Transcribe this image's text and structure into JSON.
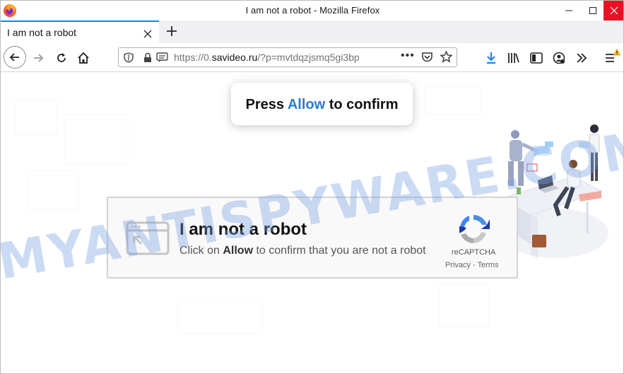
{
  "window": {
    "title": "I am not a robot - Mozilla Firefox"
  },
  "tabs": [
    {
      "label": "I am not a robot"
    }
  ],
  "url": {
    "scheme": "https://0.",
    "host": "savideo.ru",
    "path": "/?p=mvtdqzjsmq5gi3bp"
  },
  "page": {
    "press_prefix": "Press",
    "press_allow": "Allow",
    "press_suffix": "to confirm",
    "watermark": "MYANTISPYWARE.COM"
  },
  "captcha": {
    "title": "I am not a robot",
    "sub_prefix": "Click on",
    "sub_bold": "Allow",
    "sub_suffix": "to confirm that you are not a robot",
    "recaptcha": "reCAPTCHA",
    "links": "Privacy - Terms"
  },
  "colors": {
    "accent": "#2b7bd1",
    "tab_highlight": "#0a84ff",
    "close_red": "#e81123"
  },
  "icons": [
    "firefox-logo-icon",
    "back-icon",
    "forward-icon",
    "reload-icon",
    "home-icon",
    "shield-icon",
    "lock-icon",
    "permissions-icon",
    "pocket-icon",
    "star-icon",
    "download-icon",
    "library-icon",
    "sidebar-icon",
    "account-icon",
    "overflow-icon",
    "menu-icon",
    "warning-icon"
  ]
}
